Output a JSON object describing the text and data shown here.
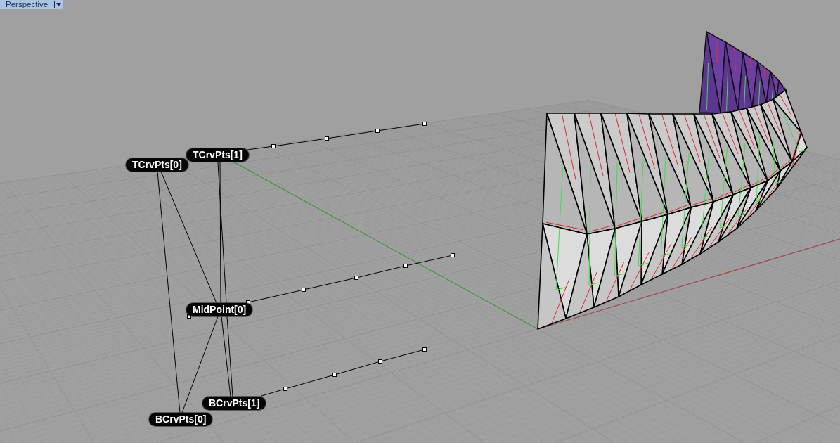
{
  "viewport": {
    "title": "Perspective"
  },
  "point_tags": [
    "TCrvPts[1]",
    "TCrvPts[0]",
    "MidPoint[0]",
    "BCrvPts[1]",
    "BCrvPts[0]"
  ]
}
